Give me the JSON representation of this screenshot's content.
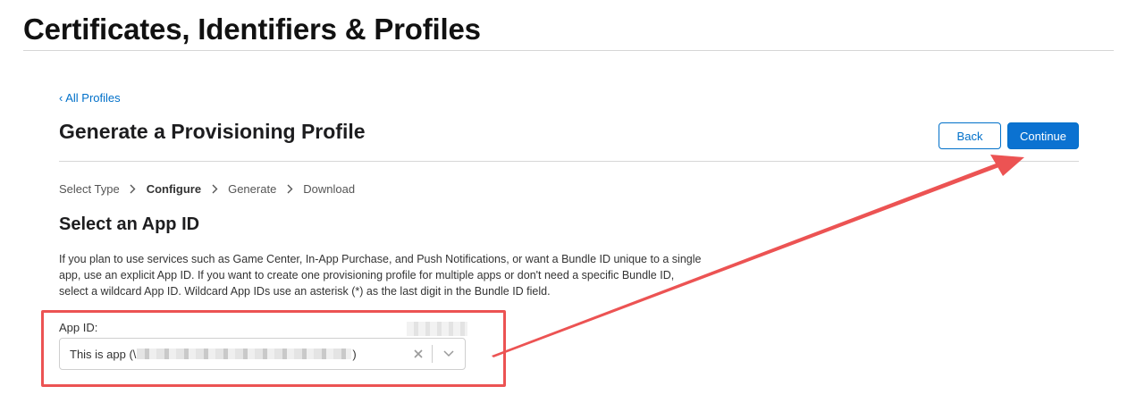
{
  "header": {
    "title": "Certificates, Identifiers & Profiles"
  },
  "nav": {
    "back_link": "‹ All Profiles"
  },
  "page": {
    "title": "Generate a Provisioning Profile",
    "buttons": {
      "back": "Back",
      "continue": "Continue"
    }
  },
  "steps": [
    {
      "label": "Select Type",
      "active": false
    },
    {
      "label": "Configure",
      "active": true
    },
    {
      "label": "Generate",
      "active": false
    },
    {
      "label": "Download",
      "active": false
    }
  ],
  "section": {
    "heading": "Select an App ID",
    "description": "If you plan to use services such as Game Center, In-App Purchase, and Push Notifications, or want a Bundle ID unique to a single app, use an explicit App ID. If you want to create one provisioning profile for multiple apps or don't need a specific Bundle ID, select a wildcard App ID. Wildcard App IDs use an asterisk (*) as the last digit in the Bundle ID field."
  },
  "app_id_field": {
    "label": "App ID:",
    "value_prefix": "This is app (\\",
    "value_suffix": ")",
    "clear_icon": "close-icon",
    "dropdown_icon": "chevron-down-icon"
  },
  "annotation": {
    "color": "#ec5353"
  },
  "colors": {
    "accent": "#0070c9",
    "button_fill": "#0b72d1"
  }
}
